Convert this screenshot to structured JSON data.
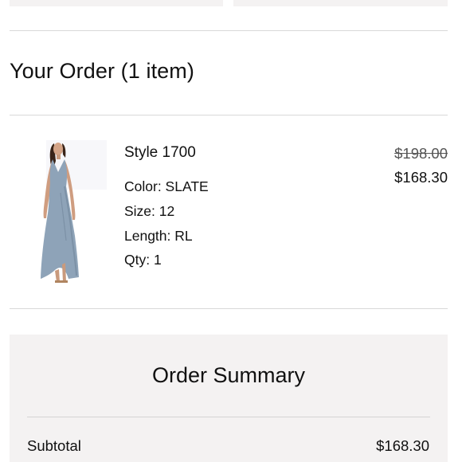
{
  "order": {
    "title": "Your Order (1 item)"
  },
  "item": {
    "name": "Style 1700",
    "color": "Color: SLATE",
    "size": "Size: 12",
    "length": "Length: RL",
    "qty": "Qty: 1",
    "original_price": "$198.00",
    "sale_price": "$168.30",
    "image_icon": "dress-photo",
    "dress_color": "#8ea3b8"
  },
  "summary": {
    "title": "Order Summary",
    "subtotal_label": "Subtotal",
    "subtotal_value": "$168.30"
  }
}
